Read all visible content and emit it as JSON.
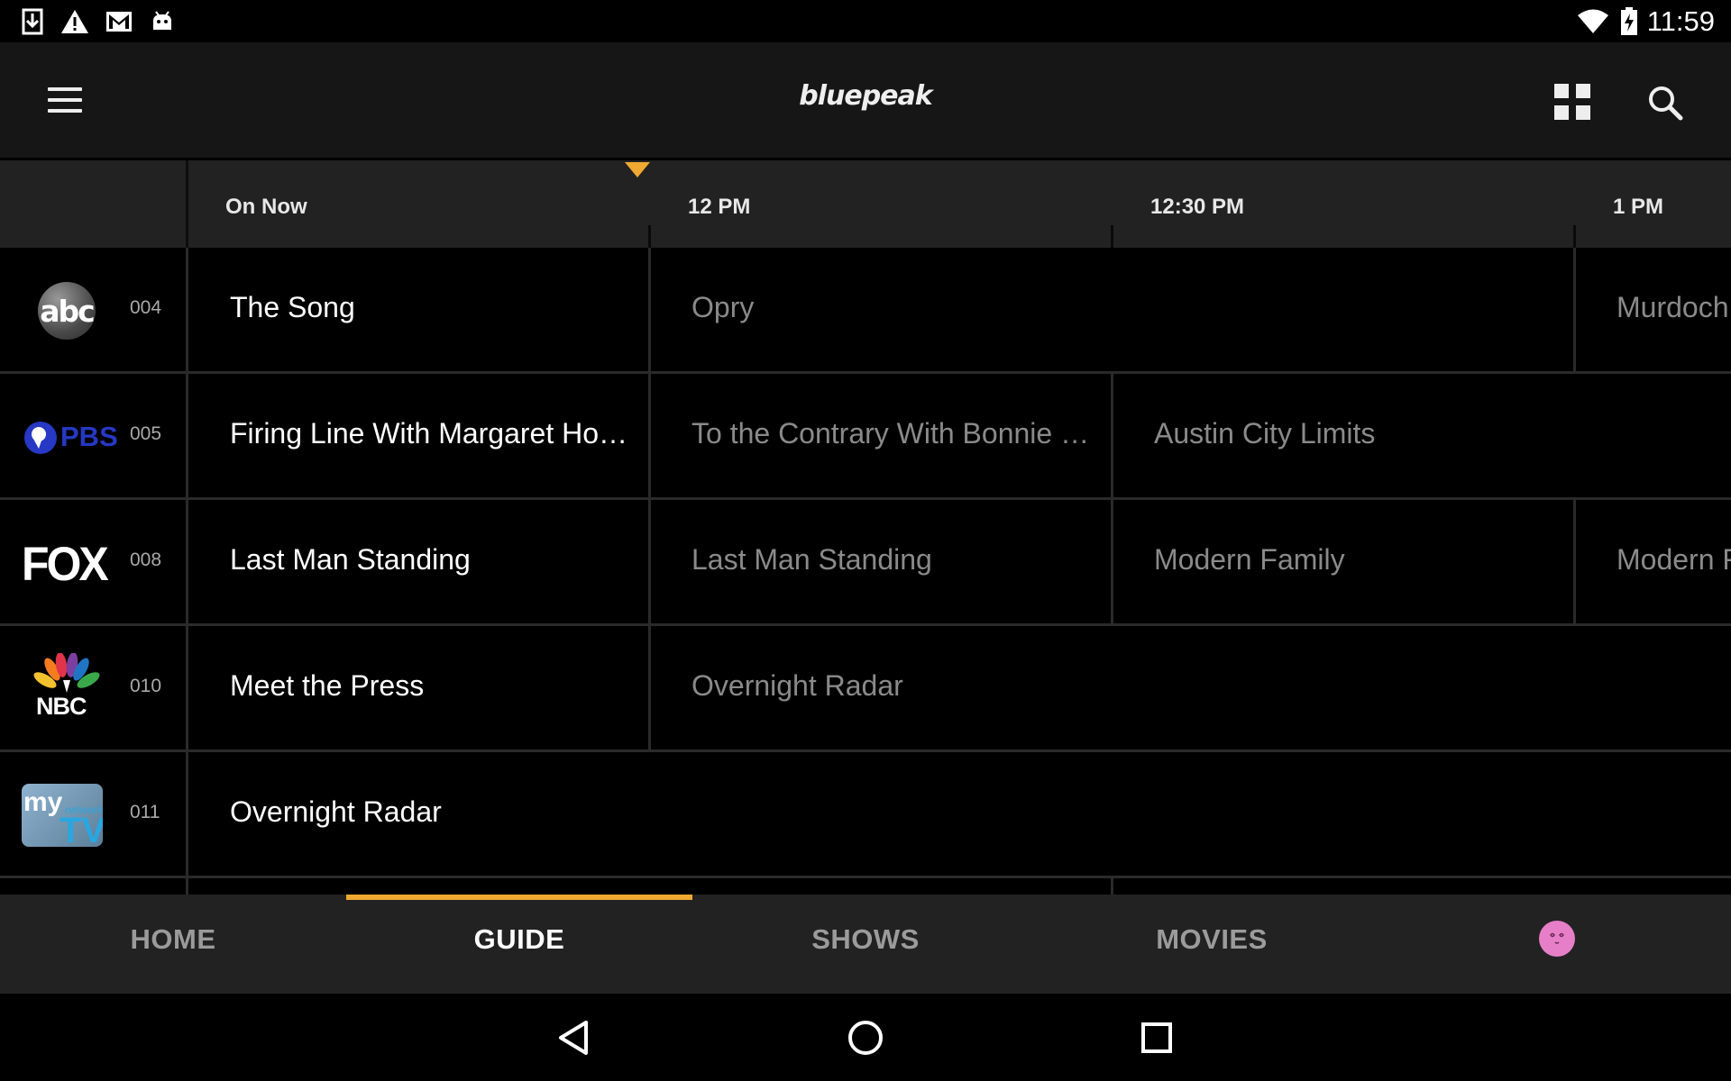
{
  "status_bar": {
    "time": "11:59",
    "left_icons": [
      "download-icon",
      "warning-icon",
      "gmail-icon",
      "android-icon"
    ],
    "right_icons": [
      "wifi-icon",
      "battery-charging-icon"
    ]
  },
  "app_bar": {
    "logo_text": "bluepeak",
    "menu_icon": "hamburger-menu-icon",
    "grid_icon": "grid-view-icon",
    "search_icon": "search-icon"
  },
  "timebar": {
    "labels": [
      "On Now",
      "12 PM",
      "12:30 PM",
      "1 PM"
    ]
  },
  "channels": [
    {
      "logo": "ABC",
      "number": "004",
      "programs": [
        "The Song",
        "Opry",
        "Murdoch"
      ]
    },
    {
      "logo": "PBS",
      "number": "005",
      "programs": [
        "Firing Line With Margaret Ho…",
        "To the Contrary With Bonnie …",
        "Austin City Limits"
      ]
    },
    {
      "logo": "FOX",
      "number": "008",
      "programs": [
        "Last Man Standing",
        "Last Man Standing",
        "Modern Family",
        "Modern F"
      ]
    },
    {
      "logo": "NBC",
      "number": "010",
      "programs": [
        "Meet the Press",
        "Overnight Radar"
      ]
    },
    {
      "logo": "my network TV",
      "number": "011",
      "programs": [
        "Overnight Radar"
      ]
    }
  ],
  "bottom_nav": {
    "tabs": [
      "HOME",
      "GUIDE",
      "SHOWS",
      "MOVIES"
    ],
    "active_tab": "GUIDE"
  },
  "colors": {
    "accent": "#f0a830",
    "background": "#000000",
    "bar": "#222222",
    "avatar": "#e67fc8"
  }
}
